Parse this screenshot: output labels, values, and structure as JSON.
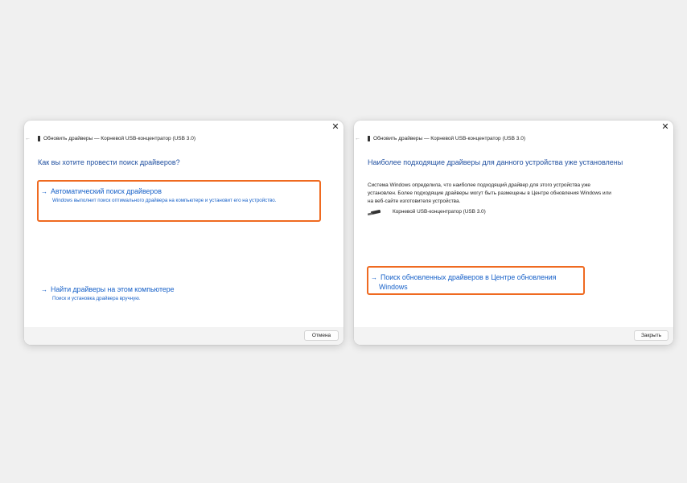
{
  "left_dialog": {
    "title": "Обновить драйверы — Корневой USB-концентратор (USB 3.0)",
    "heading": "Как вы хотите провести поиск драйверов?",
    "option_auto": {
      "title": "Автоматический поиск драйверов",
      "description": "Windows выполнит поиск оптимального драйвера на компьютере и установит его на устройство."
    },
    "option_manual": {
      "title": "Найти драйверы на этом компьютере",
      "description": "Поиск и установка драйвера вручную."
    },
    "cancel_label": "Отмена"
  },
  "right_dialog": {
    "title": "Обновить драйверы — Корневой USB-концентратор (USB 3.0)",
    "heading": "Наиболее подходящие драйверы для данного устройства уже установлены",
    "info": "Система Windows определила, что наиболее подходящий драйвер для этого устройства уже установлен. Более подходящие драйверы могут быть размещены в Центре обновления Windows или на веб-сайте изготовителя устройства.",
    "device_name": "Корневой USB-концентратор (USB 3.0)",
    "option_update": {
      "title_line1": "Поиск обновленных драйверов в Центре обновления",
      "title_line2": "Windows"
    },
    "close_label": "Закрыть"
  },
  "icons": {
    "close": "close-icon",
    "back": "back-arrow-icon",
    "arrow": "arrow-right-icon",
    "usb": "usb-icon"
  },
  "colors": {
    "background": "#f0f0f0",
    "link_blue": "#1660c8",
    "heading_blue": "#1f4fa0",
    "highlight_orange": "#ef6a20"
  }
}
